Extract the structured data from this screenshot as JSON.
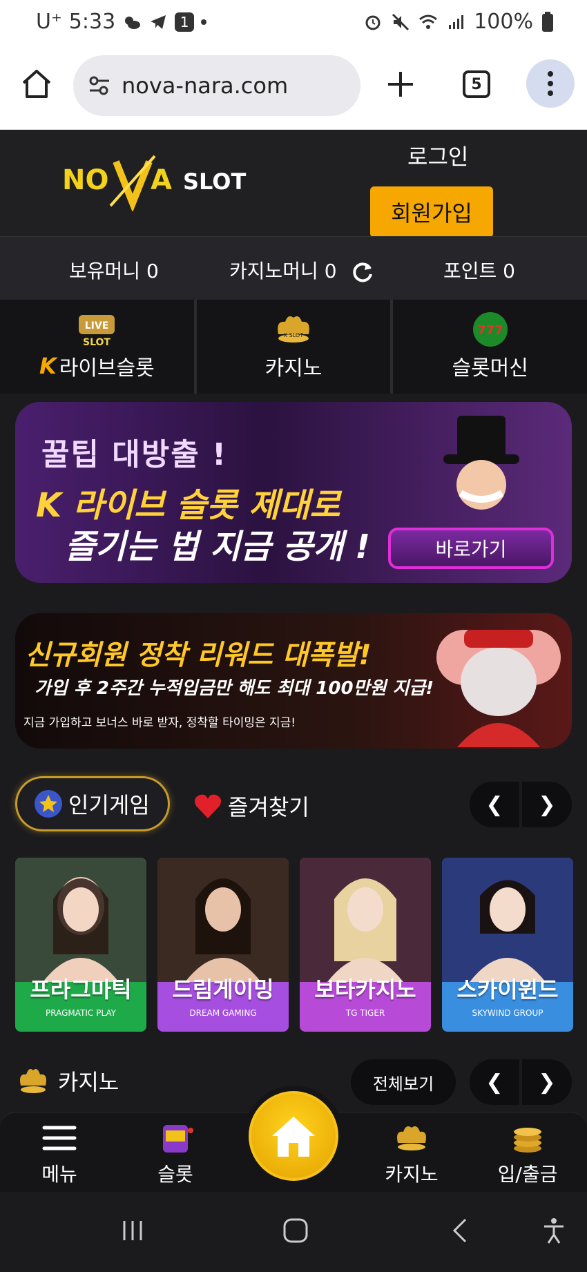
{
  "status": {
    "carrier": "U⁺",
    "time": "5:33",
    "notif_badge": "1",
    "battery": "100%"
  },
  "browser": {
    "url": "nova-nara.com",
    "tab_count": "5"
  },
  "header": {
    "logo_text": "NOVA SLOT",
    "login": "로그인",
    "signup": "회원가입"
  },
  "money": {
    "held": "보유머니 0",
    "casino": "카지노머니 0",
    "points": "포인트 0"
  },
  "categories": [
    {
      "label": "라이브슬롯",
      "icon": "live-slot-icon",
      "prefix": "K"
    },
    {
      "label": "카지노",
      "icon": "casino-crown-icon"
    },
    {
      "label": "슬롯머신",
      "icon": "slot-777-icon"
    }
  ],
  "banner1": {
    "line1": "꿀팁 대방출 !",
    "line2": "K 라이브 슬롯 제대로",
    "line3": "즐기는 법 지금 공개 !",
    "button": "바로가기"
  },
  "banner2": {
    "line1": "신규회원 정착 리워드 대폭발!",
    "line2": "가입 후 2주간 누적입금만 해도 최대 100만원 지급!",
    "line3": "지금 가입하고 보너스 바로 받자, 정착할 타이밍은 지금!"
  },
  "tabs": {
    "popular": "인기게임",
    "favorites": "즐겨찾기"
  },
  "games": [
    {
      "name": "프라그마틱",
      "brand": "PRAGMATIC PLAY",
      "color": "#1faa4a"
    },
    {
      "name": "드림게이밍",
      "brand": "DREAM GAMING",
      "color": "#a64ee0"
    },
    {
      "name": "보타카지노",
      "brand": "TG TIGER",
      "color": "#b84ad8"
    },
    {
      "name": "스카이윈드",
      "brand": "SKYWIND GROUP",
      "color": "#3a8ee0"
    }
  ],
  "casino_section": {
    "title": "카지노",
    "view_all": "전체보기"
  },
  "bottom_nav": {
    "menu": "메뉴",
    "slot": "슬롯",
    "casino": "카지노",
    "deposit": "입/출금"
  },
  "colors": {
    "accent": "#f6a800",
    "bg": "#1b1b1e"
  }
}
